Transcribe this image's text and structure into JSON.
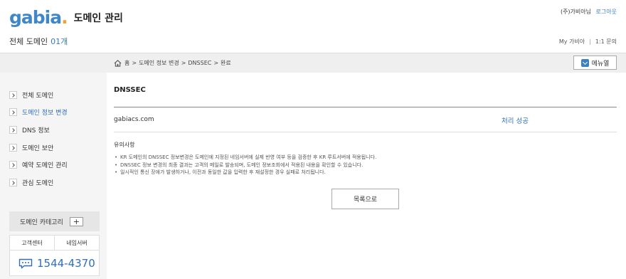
{
  "header": {
    "logo_text": "gabia",
    "logo_dot": ".",
    "app_title": "도메인 관리",
    "user_name": "(주)가비아님",
    "logout_label": "로그아웃",
    "domain_count_label": "전체 도메인",
    "domain_count_value": "01개",
    "links": [
      "My 가비아",
      "1:1 문의"
    ],
    "link_separator": "|"
  },
  "breadcrumb": {
    "items": [
      "홈",
      "도메인 정보 변경",
      "DNSSEC",
      "완료"
    ],
    "separator": ">"
  },
  "menu_button_label": "메뉴열",
  "sidebar": {
    "items": [
      {
        "label": "전체 도메인",
        "active": false
      },
      {
        "label": "도메인 정보 변경",
        "active": true
      },
      {
        "label": "DNS 정보",
        "active": false
      },
      {
        "label": "도메인 보안",
        "active": false
      },
      {
        "label": "예약 도메인 관리",
        "active": false
      },
      {
        "label": "관심 도메인",
        "active": false
      }
    ],
    "category_label": "도메인 카테고리",
    "category_add": "+",
    "support_tabs": [
      "고객센터",
      "네임서버"
    ],
    "phone": "1544-4370"
  },
  "main": {
    "title": "DNSSEC",
    "result": {
      "domain": "gabiacs.com",
      "status": "처리 성공"
    },
    "notice_title": "유의사항",
    "notices": [
      "KR 도메인의 DNSSEC 정보변경은 도메인에 지정된 네임서버에 실제 반영 여부 등을 검증한 후 KR 루트서버에 적용됩니다.",
      "DNSSEC 정보 변경의 최종 결과는 고객의 메일로 발송되며, 도메인 정보조회에서 적용된 내용을 확인할 수 있습니다.",
      "일시적인 통신 장애가 발생하거나, 이전과 동일한 값을 입력한 후 재설정한 경우 실패로 처리됩니다."
    ],
    "list_button_label": "목록으로"
  },
  "colors": {
    "accent_blue": "#2f6fba",
    "logo_blue": "#3f87c6",
    "logo_orange": "#f0a131",
    "band_grey": "#efefef"
  }
}
